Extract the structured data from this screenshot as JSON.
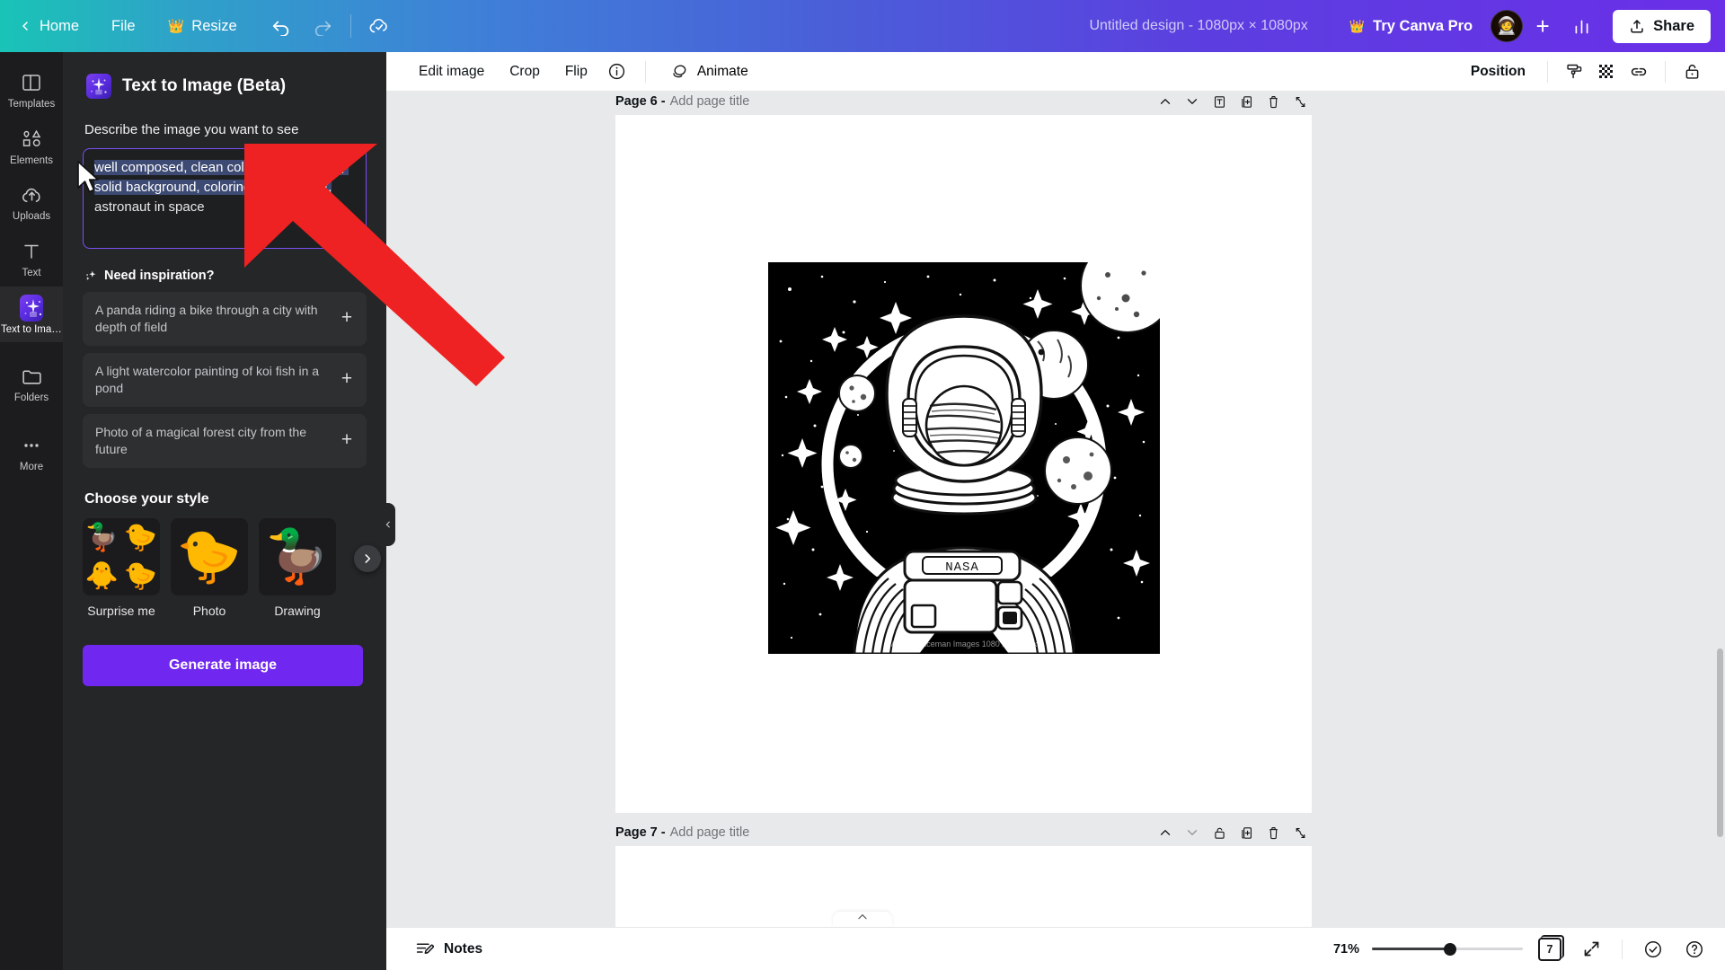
{
  "topbar": {
    "back_label": "",
    "home_label": "Home",
    "file_label": "File",
    "resize_label": "Resize",
    "resize_icon": "crown-icon",
    "undo_icon": "undo-icon",
    "redo_icon": "redo-icon",
    "cloud_icon": "cloud-saved-icon",
    "design_title": "Untitled design - 1080px × 1080px",
    "pro_label": "Try Canva Pro",
    "pro_icon": "crown-icon",
    "avatar_glyph": "🧑‍🚀",
    "plus_label": "+",
    "analytics_icon": "bar-chart-icon",
    "share_label": "Share",
    "share_icon": "share-upload-icon"
  },
  "rail": {
    "items": [
      {
        "label": "Templates",
        "icon": "templates-icon",
        "active": false
      },
      {
        "label": "Elements",
        "icon": "elements-icon",
        "active": false
      },
      {
        "label": "Uploads",
        "icon": "uploads-cloud-icon",
        "active": false
      },
      {
        "label": "Text",
        "icon": "text-t-icon",
        "active": false
      },
      {
        "label": "Text to Imag...",
        "icon": "text-to-image-icon",
        "active": true
      },
      {
        "label": "Folders",
        "icon": "folders-icon",
        "active": false
      },
      {
        "label": "More",
        "icon": "more-dots-icon",
        "active": false
      }
    ]
  },
  "panel": {
    "title": "Text to Image (Beta)",
    "describe_label": "Describe the image you want to see",
    "prompt_selected": "well composed, clean coloring book page, solid background, coloring book line art,",
    "prompt_tail": " astronaut in space",
    "prompt_placeholder": "Describe the image you want to see",
    "inspiration_label": "Need inspiration?",
    "inspiration_icon": "sparkle-icon",
    "inspirations": [
      {
        "text": "A panda riding a bike through a city with depth of field",
        "add": "+"
      },
      {
        "text": "A light watercolor painting of koi fish in a pond",
        "add": "+"
      },
      {
        "text": "Photo of a magical forest city from the future",
        "add": "+"
      }
    ],
    "style_label": "Choose your style",
    "styles": [
      {
        "caption": "Surprise me",
        "thumb": "quad-ducks"
      },
      {
        "caption": "Photo",
        "thumb": "duck-photo"
      },
      {
        "caption": "Drawing",
        "thumb": "duck-drawing"
      }
    ],
    "next_styles_icon": "chevron-right-icon",
    "generate_label": "Generate image",
    "collapse_icon": "chevron-left-icon"
  },
  "editor_toolbar": {
    "edit_image": "Edit image",
    "crop": "Crop",
    "flip": "Flip",
    "info_icon": "info-circle-icon",
    "animate": "Animate",
    "animate_icon": "animate-icon",
    "position": "Position",
    "transparency_icon": "transparency-icon",
    "checker_icon": "checkerboard-icon",
    "link_icon": "link-icon",
    "lock_icon": "lock-icon"
  },
  "canvas": {
    "pages": [
      {
        "number_label": "Page 6 -",
        "title_placeholder": "Add page title",
        "tools": [
          "chevron-up-icon",
          "chevron-down-icon",
          "add-title-icon",
          "duplicate-icon",
          "delete-icon",
          "expand-icon"
        ],
        "has_art": true
      },
      {
        "number_label": "Page 7 -",
        "title_placeholder": "Add page title",
        "tools": [
          "chevron-up-icon",
          "chevron-down-icon",
          "lock-icon",
          "duplicate-icon",
          "delete-icon",
          "expand-icon"
        ],
        "has_art": false
      }
    ],
    "artwork": {
      "description": "astronaut in space coloring book line art, black background with stars and planets",
      "chest_label": "NASA",
      "caption": "Astro Spaceman Images   1080 x 1080 px"
    }
  },
  "bottombar": {
    "notes_label": "Notes",
    "notes_icon": "notes-icon",
    "zoom_percent": "71%",
    "zoom_value": 71,
    "page_count": "7",
    "pagecount_icon": "page-count-icon",
    "fullscreen_icon": "fullscreen-icon",
    "help_icon": "help-circle-icon",
    "check_icon": "check-circle-icon",
    "pageflip_icon": "chevron-up-icon"
  },
  "annotation": {
    "arrow_color": "#ee2222",
    "arrow_label": "red-pointer-arrow"
  },
  "colors": {
    "brand_purple": "#7028f0",
    "panel_bg": "#252627",
    "rail_bg": "#1c1c1e",
    "canvas_bg": "#e8e9ea",
    "selection_blue": "#3d4a73"
  }
}
